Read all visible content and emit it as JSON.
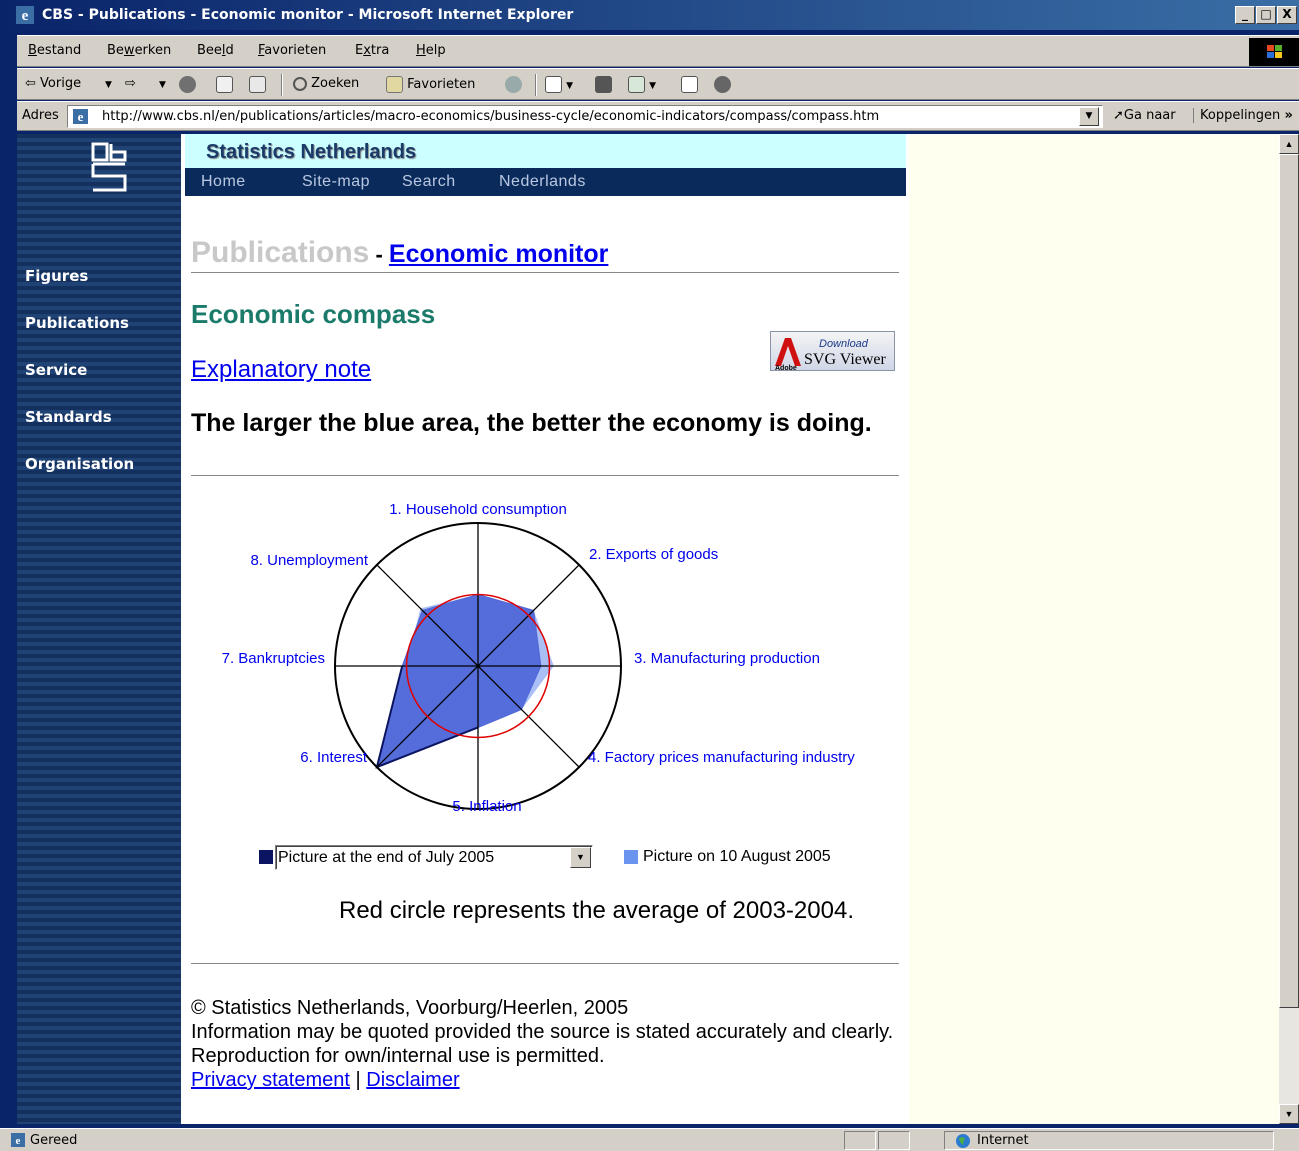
{
  "window": {
    "title": "CBS - Publications - Economic monitor - Microsoft Internet Explorer",
    "minimize": "_",
    "maximize": "□",
    "close": "X"
  },
  "menu": [
    "Bestand",
    "Bewerken",
    "Beeld",
    "Favorieten",
    "Extra",
    "Help"
  ],
  "toolbar": {
    "back": "⇦ Vorige",
    "search": "Zoeken",
    "favorites": "Favorieten"
  },
  "address": {
    "label": "Adres",
    "url": "http://www.cbs.nl/en/publications/articles/macro-economics/business-cycle/economic-indicators/compass/compass.htm",
    "go": "Ga naar",
    "links": "Koppelingen",
    "links_more": "»"
  },
  "sidebar": {
    "items": [
      "Figures",
      "Publications",
      "Service",
      "Standards",
      "Organisation"
    ]
  },
  "header": {
    "site": "Statistics Netherlands",
    "nav": [
      "Home",
      "Site-map",
      "Search",
      "Nederlands"
    ]
  },
  "page": {
    "section": "Publications",
    "section_sep": " - ",
    "breadcrumb_link": "Economic monitor",
    "title": "Economic compass",
    "explanatory_link": "Explanatory note",
    "svg_badge_line1": "Download",
    "svg_badge_line2": "SVG Viewer",
    "svg_badge_brand": "Adobe",
    "lead": "The larger the blue area, the better the economy is doing.",
    "legend_select": "Picture at the end of July 2005",
    "legend_other": "Picture on 10 August 2005",
    "red_circle_note": "Red circle represents the average of 2003-2004."
  },
  "footer": {
    "copyright": "© Statistics Netherlands, Voorburg/Heerlen, 2005",
    "quote": "Information may be quoted provided the source is stated accurately and clearly.",
    "repro": "Reproduction for own/internal use is permitted.",
    "privacy": "Privacy statement",
    "sep": " | ",
    "disclaimer": "Disclaimer"
  },
  "status": {
    "text": "Gereed",
    "zone": "Internet"
  },
  "chart_data": {
    "type": "radar",
    "axes": [
      "1. Household consumption",
      "2. Exports of goods",
      "3. Manufacturing production",
      "4. Factory prices manufacturing industry",
      "5. Inflation",
      "6. Interest",
      "7. Bankruptcies",
      "8. Unemployment"
    ],
    "scale_max": 1.0,
    "reference_circle": 0.5,
    "series": [
      {
        "name": "Picture at the end of July 2005",
        "values": [
          0.5,
          0.55,
          0.44,
          0.43,
          0.43,
          1.0,
          0.53,
          0.55
        ],
        "color": "#0b1460"
      },
      {
        "name": "Picture on 10 August 2005",
        "values": [
          0.5,
          0.55,
          0.53,
          0.43,
          0.43,
          1.0,
          0.5,
          0.57
        ],
        "color": "#6b94f0"
      }
    ],
    "colors": {
      "grid": "#000000",
      "reference": "#e00000",
      "axis_label": "#0000ee",
      "area": "#5068d8",
      "area_light": "#a9bff5"
    }
  }
}
